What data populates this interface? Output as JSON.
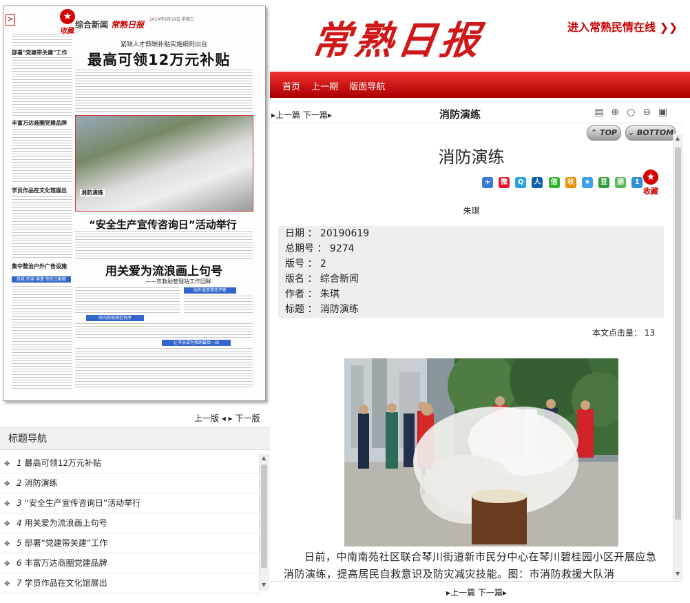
{
  "paper": {
    "section": "综合新闻",
    "masthead": "常熟日报",
    "date_line": "2019年6月19日 星期三",
    "subhead": "紧缺人才薪酬补贴实施细则出台",
    "headline": "最高可领12万元补贴",
    "side_title_1": "部署\"党建带关建\"工作",
    "side_title_2": "丰富万达商圈党建品牌",
    "side_title_3": "学员作品在文化馆展出",
    "side_title_4": "集中整治户外广告设施",
    "photo_caption": "消防演练",
    "headline_2": "“安全生产宣传咨询日”活动举行",
    "headline_3": "用关爱为流浪画上句号",
    "subhead_3": "——市救助管理站工作回眸",
    "bar_1": "站外巡查常态不断",
    "bar_2": "站内救助规范有序",
    "bar_3": "让寻亲成为救助最后一站",
    "bar_left": "折纸·印染·非遗 快乐过暑假",
    "favorite": "收藏",
    "arrow": ">",
    "star": "★"
  },
  "left_pager": {
    "prev": "上一版",
    "next": "下一版"
  },
  "nav": {
    "heading": "标题导航",
    "items": [
      {
        "num": "1",
        "title": "最高可领12万元补贴"
      },
      {
        "num": "2",
        "title": "消防演练"
      },
      {
        "num": "3",
        "title": "“安全生产宣传咨询日”活动举行"
      },
      {
        "num": "4",
        "title": "用关爱为流浪画上句号"
      },
      {
        "num": "5",
        "title": "部署“党建带关建”工作"
      },
      {
        "num": "6",
        "title": "丰富万达商圈党建品牌"
      },
      {
        "num": "7",
        "title": "学员作品在文化馆展出"
      }
    ]
  },
  "site": {
    "logo": "常熟日报",
    "minqing": "进入常熟民情在线 ❯❯",
    "nav_home": "首页",
    "nav_prev_issue": "上一期",
    "nav_layout": "版面导航"
  },
  "toolbar": {
    "prev": "上一篇",
    "next": "下一篇",
    "title": "消防演练",
    "btn_top": "TOP",
    "btn_bottom": "BOTTOM"
  },
  "article": {
    "title": "消防演练",
    "author": "朱琪",
    "favorite": "收藏",
    "meta": [
      {
        "label": "日期",
        "value": "20190619"
      },
      {
        "label": "总期号",
        "value": "9274"
      },
      {
        "label": "版号",
        "value": "2"
      },
      {
        "label": "版名",
        "value": "综合新闻"
      },
      {
        "label": "作者",
        "value": "朱琪"
      },
      {
        "label": "标题",
        "value": "消防演练"
      }
    ],
    "clicks_label": "本文点击量：",
    "clicks": "13",
    "caption": "日前，中南南苑社区联合琴川街道新市民分中心在琴川碧桂园小区开展应急消防演练，提高居民自救意识及防灾减灾技能。图：市消防救援大队消"
  },
  "bottom_nav": {
    "prev": "上一篇",
    "next": "下一篇"
  }
}
